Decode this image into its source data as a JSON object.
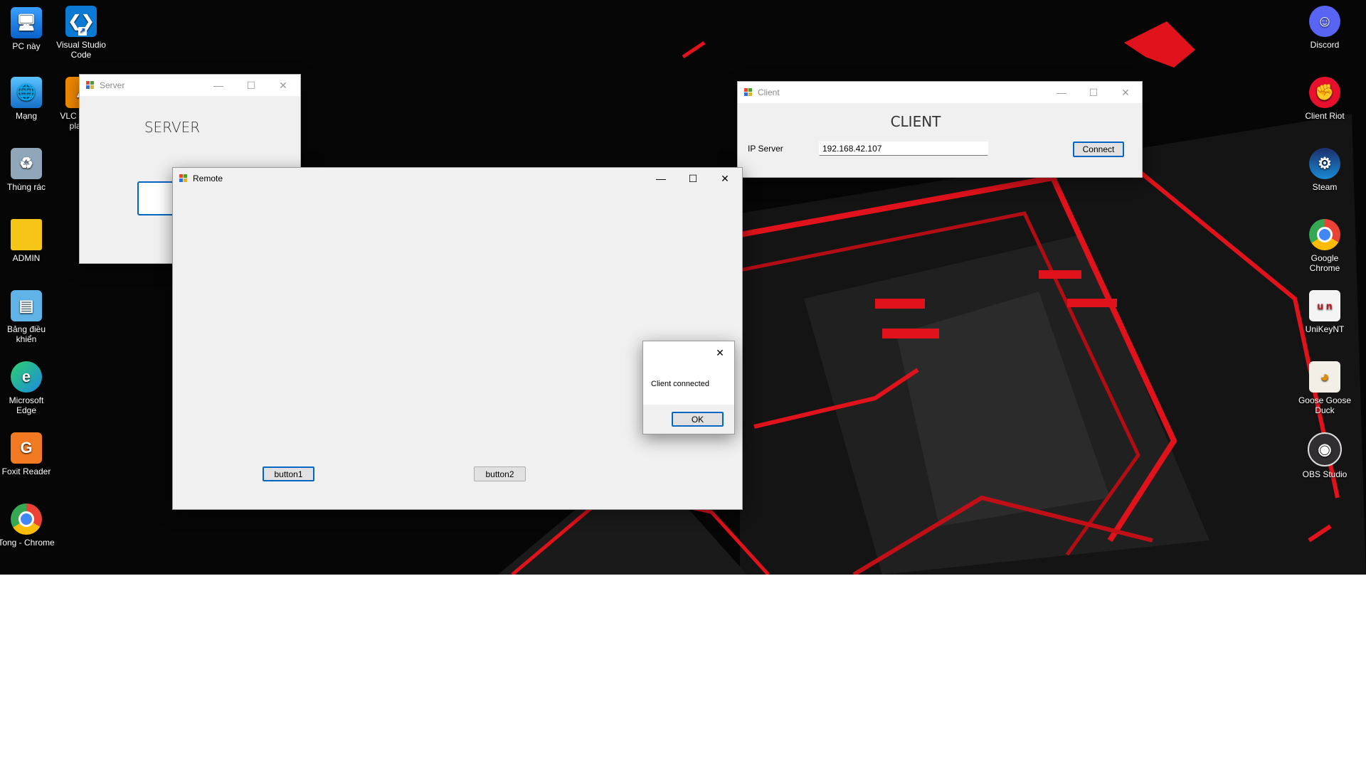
{
  "desktop_icons_left": [
    {
      "label": "PC này",
      "icon": "computer-icon"
    },
    {
      "label": "Visual Studio Code",
      "icon": "vscode-icon"
    },
    {
      "label": "Mạng",
      "icon": "network-icon"
    },
    {
      "label": "VLC media player",
      "icon": "vlc-icon"
    },
    {
      "label": "Thùng rác",
      "icon": "recycle-bin-icon"
    },
    {
      "label": "ADMIN",
      "icon": "folder-icon"
    },
    {
      "label": "Bảng điều khiển",
      "icon": "control-panel-icon"
    },
    {
      "label": "Microsoft Edge",
      "icon": "edge-icon"
    },
    {
      "label": "Foxit Reader",
      "icon": "foxit-icon"
    },
    {
      "label": "Tong - Chrome",
      "icon": "chrome-icon"
    }
  ],
  "desktop_icons_right": [
    {
      "label": "Discord",
      "icon": "discord-icon"
    },
    {
      "label": "Client Riot",
      "icon": "riot-icon"
    },
    {
      "label": "Steam",
      "icon": "steam-icon"
    },
    {
      "label": "Google Chrome",
      "icon": "chrome-icon"
    },
    {
      "label": "UniKeyNT",
      "icon": "unikey-icon"
    },
    {
      "label": "Goose Goose Duck",
      "icon": "goose-icon"
    },
    {
      "label": "OBS Studio",
      "icon": "obs-icon"
    }
  ],
  "server_window": {
    "title": "Server",
    "heading": "SERVER"
  },
  "client_window": {
    "title": "Client",
    "heading": "CLIENT",
    "ip_label": "IP Server",
    "ip_value": "192.168.42.107",
    "connect_label": "Connect"
  },
  "remote_window": {
    "title": "Remote",
    "button1_label": "button1",
    "button2_label": "button2"
  },
  "message_box": {
    "message": "Client connected",
    "ok_label": "OK"
  },
  "window_controls": {
    "minimize": "—",
    "maximize": "☐",
    "close": "✕"
  },
  "colors": {
    "accent": "#0067c0",
    "wallpaper_red": "#e0121b",
    "window_bg": "#f0f0f0"
  }
}
